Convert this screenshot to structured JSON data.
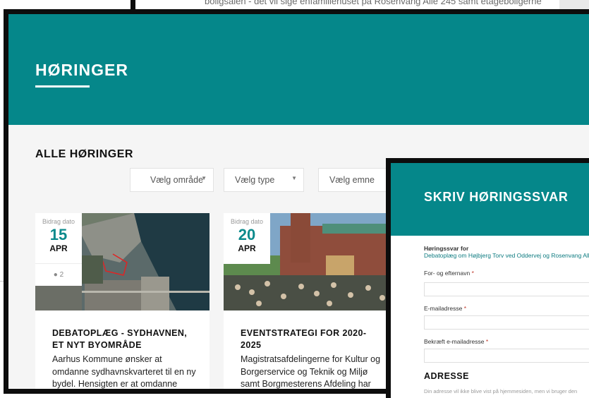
{
  "background_window": {
    "snippet": "boligsalen - det vil sige enfamiliehuset på Rosenvang Allé 245 samt etageboligerne"
  },
  "page": {
    "hero_title": "HØRINGER",
    "section_title": "ALLE HØRINGER",
    "filters": [
      {
        "label": "Vælg område"
      },
      {
        "label": "Vælg type"
      },
      {
        "label": "Vælg emne"
      }
    ],
    "cards": [
      {
        "date_caption": "Bidrag dato",
        "day": "15",
        "month": "APR",
        "comments": "2",
        "title_line1": "DEBATOPLÆG - SYDHAVNEN,",
        "title_line2": "ET NYT BYOMRÅDE",
        "excerpt": "Aarhus Kommune ønsker at omdanne sydhavnskvarteret til en ny bydel. Hensigten er at omdanne"
      },
      {
        "date_caption": "Bidrag dato",
        "day": "20",
        "month": "APR",
        "title_line1": "EVENTSTRATEGI FOR 2020-",
        "title_line2": "2025",
        "excerpt": "Magistratsafdelingerne for Kultur og Borgerservice og Teknik og Miljø samt Borgmesterens Afdeling har"
      }
    ]
  },
  "form_window": {
    "title": "SKRIV HØRINGSSVAR",
    "for_label": "Høringssvar for",
    "for_link": "Debatoplæg om Højbjerg Torv ved Oddervej og Rosenvang Allé",
    "fields": [
      {
        "label": "For- og efternavn",
        "required": "*"
      },
      {
        "label": "E-mailadresse",
        "required": "*"
      },
      {
        "label": "Bekræft e-mailadresse",
        "required": "*"
      }
    ],
    "address_heading": "ADRESSE",
    "address_note": "Din adresse vil ikke blive vist på hjemmesiden, men vi bruger den"
  },
  "colors": {
    "brand_teal": "#05878a",
    "accent_teal_text": "#0c8a8c",
    "window_frame": "#0d0d0d",
    "page_bg": "#f5f5f5"
  },
  "icons": {
    "comment": "comment-icon",
    "dropdown": "caret-down-icon"
  }
}
